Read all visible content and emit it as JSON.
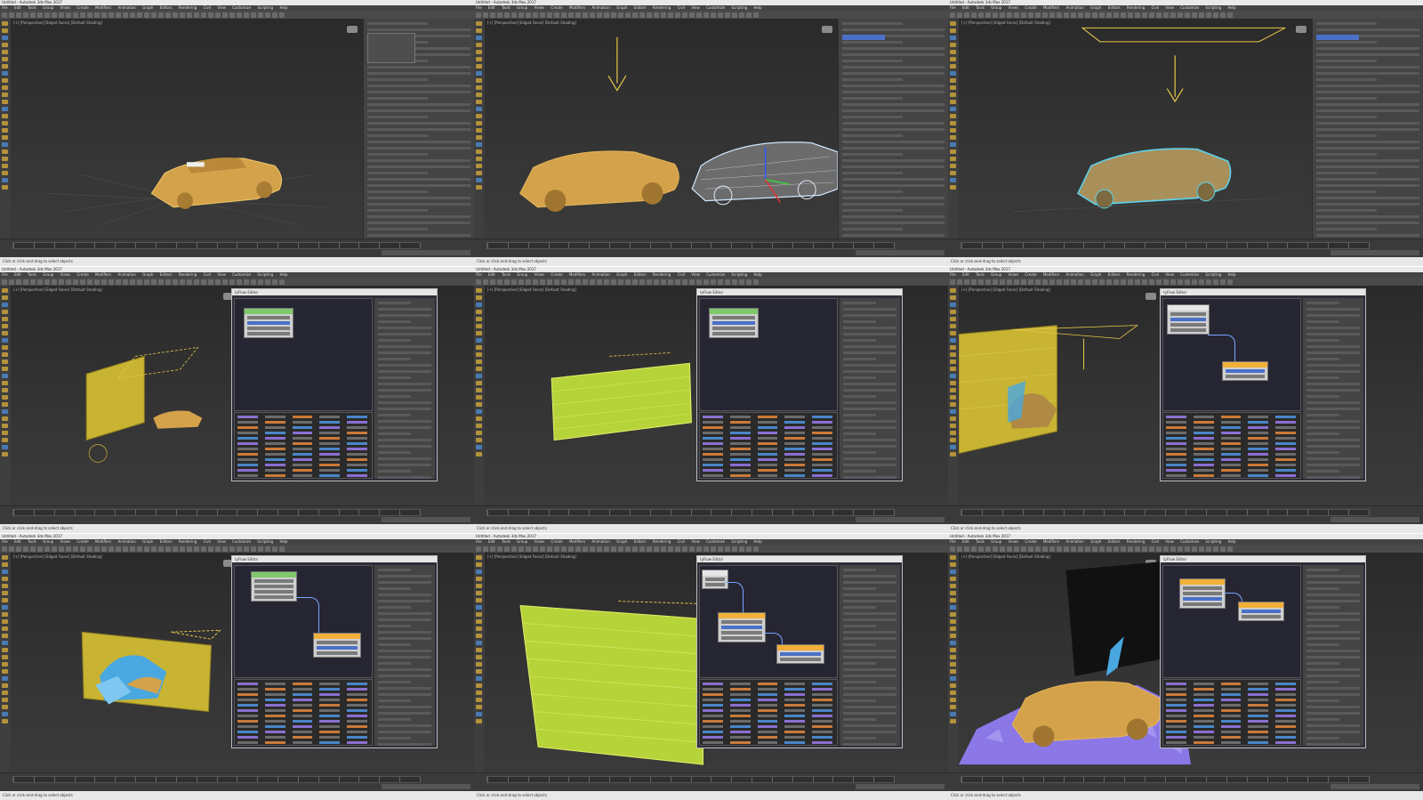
{
  "app": {
    "window_title": "Untitled - Autodesk 3ds Max 2017",
    "menu_items": [
      "File",
      "Edit",
      "Tools",
      "Group",
      "Views",
      "Create",
      "Modifiers",
      "Animation",
      "Graph Editors",
      "Rendering",
      "Civil View",
      "Customize",
      "Scripting",
      "Help"
    ],
    "viewport_label": "[+] [Perspective] [Edged Faces] [Default Shading]",
    "node_editor_title": "tyFlow Editor",
    "status_text": "Click or click-and-drag to select objects"
  },
  "colors": {
    "viewport_bg": "#353535",
    "car_orange": "#d4a24a",
    "car_cyan_outline": "#5fd0e8",
    "wall_yellow": "#c9b333",
    "wall_green": "#b7d33a",
    "shard_purple": "#8b78e6",
    "shard_blue": "#49a8e0",
    "selection_blue": "#4b70c8",
    "node_header_green": "#7fc86b",
    "node_header_orange": "#f1b03a"
  },
  "panels": [
    {
      "id": 1,
      "scene": "single orange car, wireframe selected"
    },
    {
      "id": 2,
      "scene": "orange car and cyan wireframe car copy with gizmo"
    },
    {
      "id": 3,
      "scene": "cyan outlined car under gravity arrow"
    },
    {
      "id": 4,
      "scene": "yellow wall with car and node editor"
    },
    {
      "id": 5,
      "scene": "green brick wall with node editor"
    },
    {
      "id": 6,
      "scene": "brick wall with car impact, node editor"
    },
    {
      "id": 7,
      "scene": "car crashing into wall, blue fragments"
    },
    {
      "id": 8,
      "scene": "large green brick wall, multiple nodes"
    },
    {
      "id": 9,
      "scene": "car amid purple shards, node editor"
    }
  ]
}
